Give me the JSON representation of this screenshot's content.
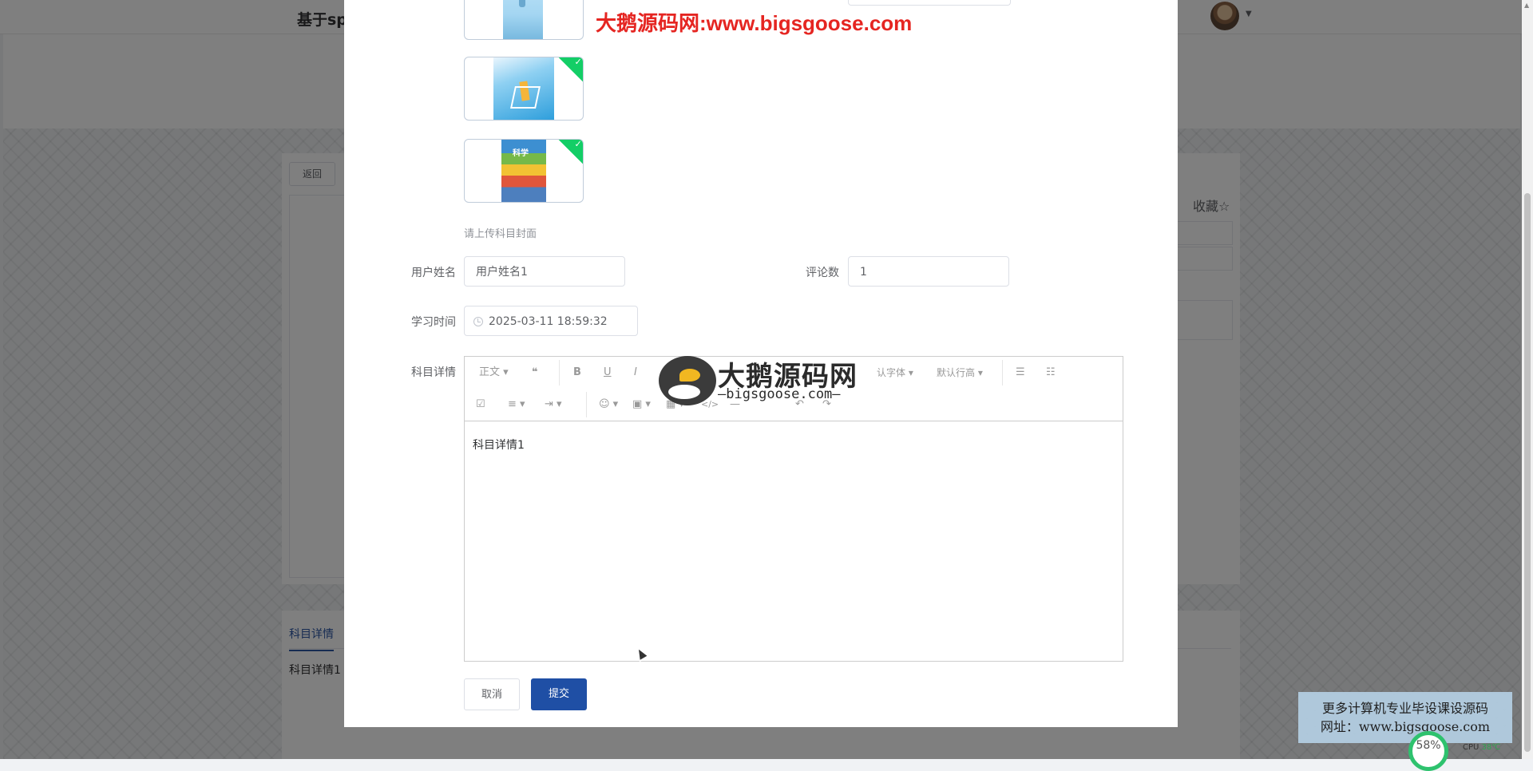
{
  "page": {
    "site_title": "基于sp",
    "back_button": "返回",
    "favorite_label": "收藏☆",
    "tab_label": "科目详情",
    "tab_content": "科目详情1"
  },
  "dialog": {
    "upload_tip": "请上传科目封面",
    "fields": {
      "username_label": "用户姓名",
      "username_value": "用户姓名1",
      "comments_label": "评论数",
      "comments_value": "1",
      "study_time_label": "学习时间",
      "study_time_value": "2025-03-11 18:59:32",
      "detail_label": "科目详情"
    },
    "editor": {
      "toolbar_row1": [
        "正文 ▾",
        "❝",
        "B",
        "U",
        "I",
        "认字体 ▾",
        "默认行高 ▾",
        "☰",
        "☷"
      ],
      "toolbar_row2": [
        "☑",
        "≡ ▾",
        "⇥ ▾",
        "☺ ▾",
        "▣ ▾",
        "▦ ▾",
        "</>",
        "—",
        "↶",
        "↷"
      ],
      "content": "科目详情1"
    },
    "buttons": {
      "cancel": "取消",
      "submit": "提交"
    },
    "accent_color": "#1f4fa5",
    "check_color": "#13ce66"
  },
  "overlays": {
    "watermark_top": "大鹅源码网:www.bigsgoose.com",
    "logo_title": "大鹅源码网",
    "logo_sub": "—bigsgoose.com—",
    "promo_line1": "更多计算机专业毕设课设源码",
    "promo_line2": "网址：www.bigsgoose.com",
    "perf_percent": "58%",
    "cpu_label": "CPU",
    "cpu_temp": "38℃"
  }
}
